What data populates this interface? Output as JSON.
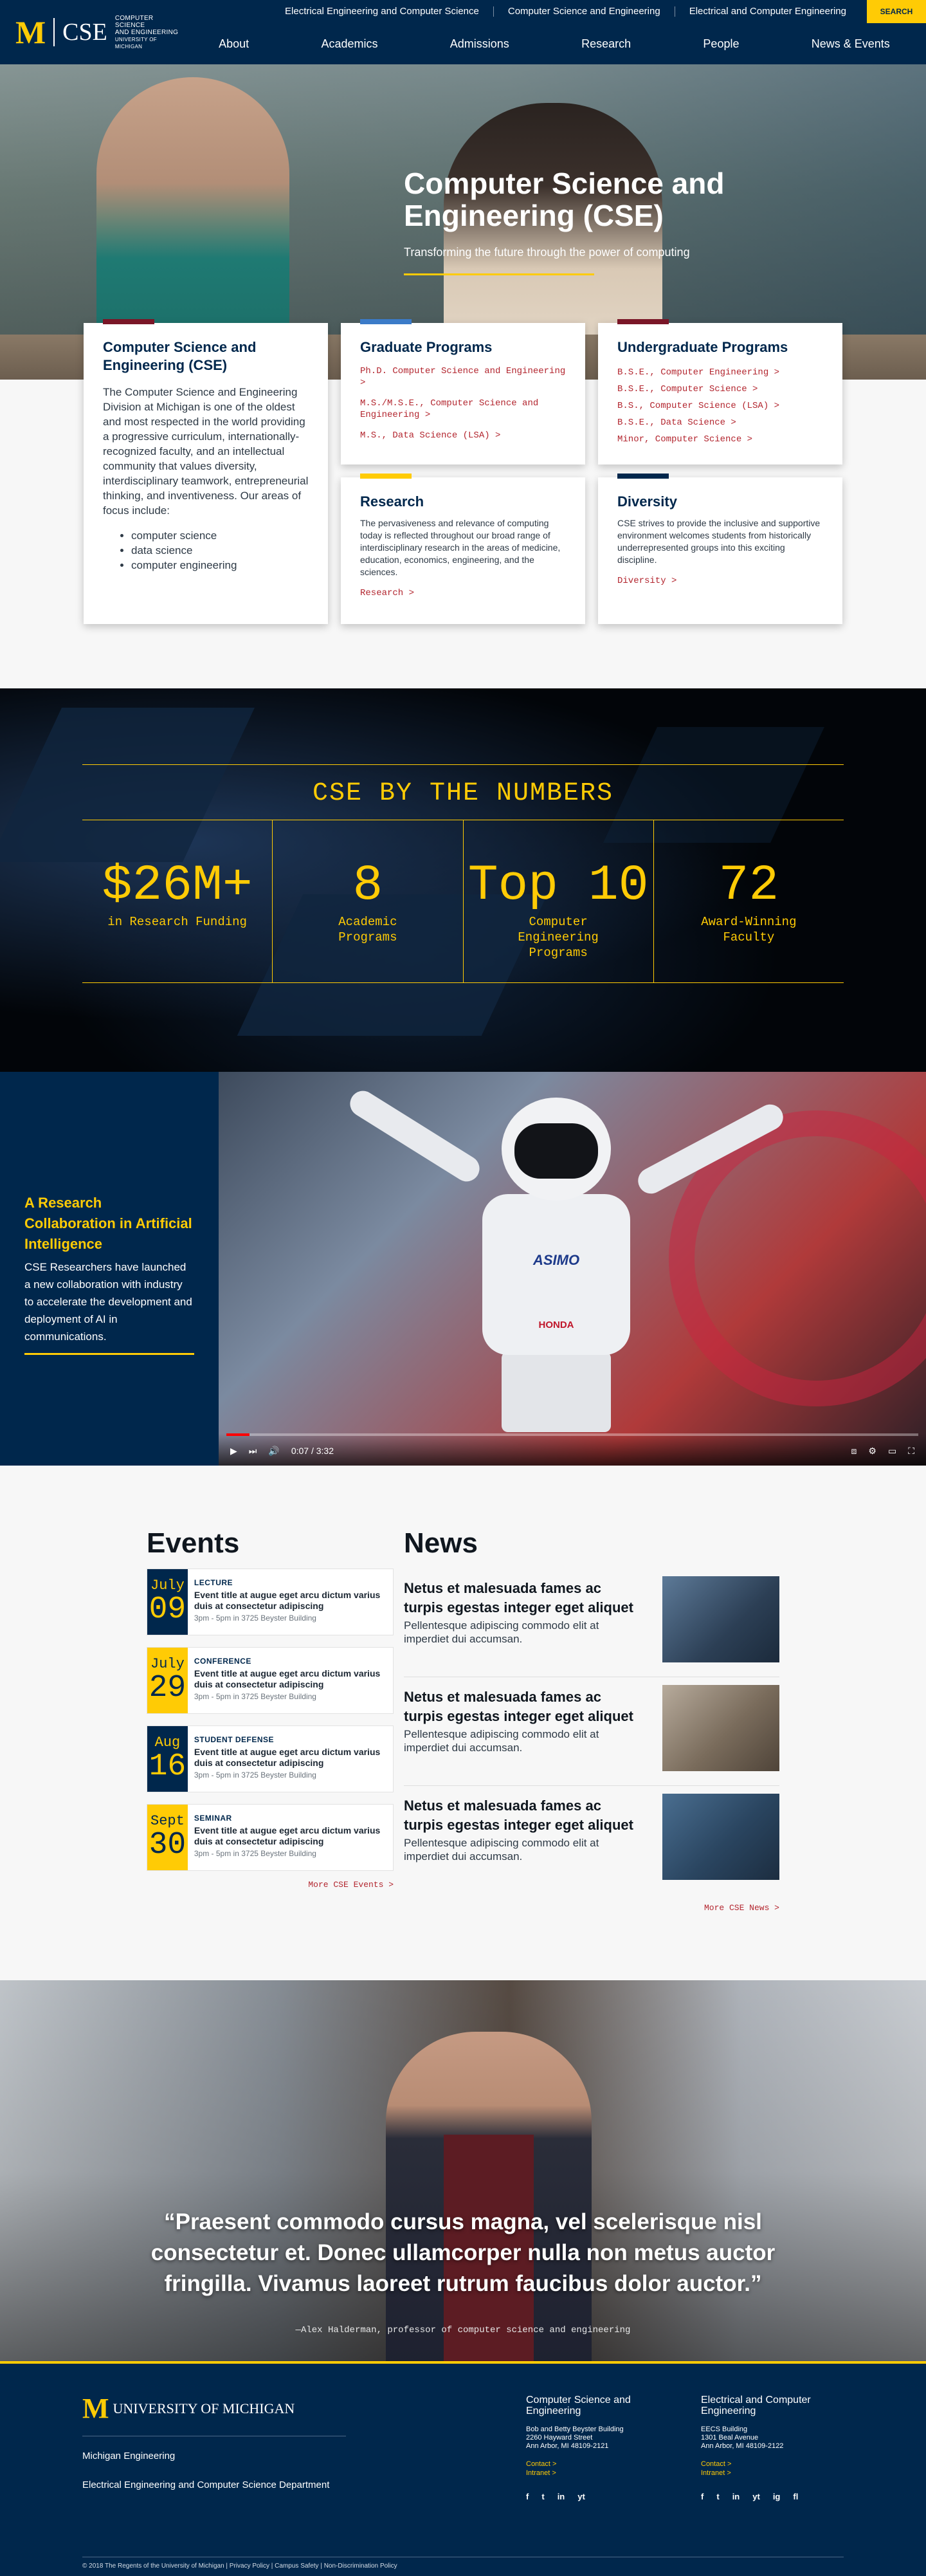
{
  "utility_bar": {
    "links": [
      "Electrical Engineering and Computer Science",
      "Computer Science and Engineering",
      "Electrical and Computer Engineering"
    ],
    "search_label": "SEARCH"
  },
  "logo": {
    "mark": "M",
    "wordmark": "CSE",
    "line1": "COMPUTER SCIENCE",
    "line2": "AND ENGINEERING",
    "line3": "UNIVERSITY OF MICHIGAN"
  },
  "nav": [
    "About",
    "Academics",
    "Admissions",
    "Research",
    "People",
    "News & Events"
  ],
  "hero": {
    "title": "Computer Science and Engineering (CSE)",
    "subtitle": "Transforming the future through the power of computing"
  },
  "cards": {
    "intro": {
      "title": "Computer Science and Engineering (CSE)",
      "body": "The Computer Science and Engineering Division at Michigan is one of the oldest and most respected in the world providing a progressive curriculum, internationally-recognized faculty, and an intellectual community that values diversity, interdisciplinary teamwork, entrepreneurial thinking, and inventiveness. Our areas of focus include:",
      "focus": [
        "computer science",
        "data science",
        "computer engineering"
      ],
      "bar_color": "#7a1627"
    },
    "graduate": {
      "title": "Graduate Programs",
      "links": [
        "Ph.D. Computer Science and Engineering >",
        "M.S./M.S.E., Computer Science and Engineering >",
        "M.S., Data Science (LSA) >"
      ],
      "bar_color": "#3b7bc8"
    },
    "undergraduate": {
      "title": "Undergraduate Programs",
      "links": [
        "B.S.E., Computer Engineering >",
        "B.S.E., Computer Science >",
        "B.S., Computer Science (LSA) >",
        "B.S.E., Data Science >",
        "Minor, Computer Science >"
      ],
      "bar_color": "#7a1627"
    },
    "research": {
      "title": "Research",
      "body": "The pervasiveness and relevance of computing today is reflected throughout our broad range of interdisciplinary research in the areas of medicine, education, economics, engineering, and the sciences.",
      "link": "Research >",
      "bar_color": "#ffcb05"
    },
    "diversity": {
      "title": "Diversity",
      "body": "CSE strives to provide the inclusive and supportive environment welcomes students from historically underrepresented groups into this exciting discipline.",
      "link": "Diversity >",
      "bar_color": "#00274c"
    }
  },
  "numbers": {
    "title": "CSE BY THE NUMBERS",
    "stats": [
      {
        "value": "$26M+",
        "label": "in Research Funding"
      },
      {
        "value": "8",
        "label": "Academic Programs"
      },
      {
        "value": "Top 10",
        "label": "Computer Engineering Programs"
      },
      {
        "value": "72",
        "label": "Award-Winning Faculty"
      }
    ]
  },
  "feature": {
    "title": "A Research Collaboration in Artificial Intelligence",
    "body": "CSE Researchers have launched a new collaboration with industry to accelerate the development and deployment of AI in communications.",
    "robot_name": "ASIMO",
    "robot_brand": "HONDA",
    "video": {
      "time": "0:07 / 3:32",
      "progress": 0.033
    }
  },
  "events": {
    "title": "Events",
    "items": [
      {
        "month": "July",
        "day": "09",
        "type": "LECTURE",
        "title": "Event title at augue eget arcu dictum varius duis at consectetur adipiscing",
        "location": "3pm - 5pm in 3725 Beyster Building",
        "style": "blue"
      },
      {
        "month": "July",
        "day": "29",
        "type": "CONFERENCE",
        "title": "Event title at augue eget arcu dictum varius duis at consectetur adipiscing",
        "location": "3pm - 5pm in 3725 Beyster Building",
        "style": "yellow"
      },
      {
        "month": "Aug",
        "day": "16",
        "type": "STUDENT DEFENSE",
        "title": "Event title at augue eget arcu dictum varius duis at consectetur adipiscing",
        "location": "3pm - 5pm in 3725 Beyster Building",
        "style": "blue"
      },
      {
        "month": "Sept",
        "day": "30",
        "type": "SEMINAR",
        "title": "Event title at augue eget arcu dictum varius duis at consectetur adipiscing",
        "location": "3pm - 5pm in 3725 Beyster Building",
        "style": "yellow"
      }
    ],
    "more": "More CSE Events >"
  },
  "news": {
    "title": "News",
    "items": [
      {
        "title": "Netus et malesuada fames ac turpis egestas integer eget aliquet",
        "body": "Pellentesque adipiscing commodo elit at imperdiet dui accumsan.",
        "image_color": "#3e5670"
      },
      {
        "title": "Netus et malesuada fames ac turpis egestas integer eget aliquet",
        "body": "Pellentesque adipiscing commodo elit at imperdiet dui accumsan.",
        "image_color": "#8b7f72"
      },
      {
        "title": "Netus et malesuada fames ac turpis egestas integer eget aliquet",
        "body": "Pellentesque adipiscing commodo elit at imperdiet dui accumsan.",
        "image_color": "#2f4a63"
      }
    ],
    "more": "More CSE News >"
  },
  "quote": {
    "text": "“Praesent commodo cursus magna, vel scelerisque nisl consectetur et. Donec ullamcorper nulla non metus auctor fringilla. Vivamus laoreet rutrum faucibus dolor auctor.”",
    "attribution": "—Alex Halderman, professor of computer science and engineering"
  },
  "footer": {
    "logo_mark": "M",
    "logo_text": "UNIVERSITY OF MICHIGAN",
    "link1": "Michigan Engineering",
    "link2": "Electrical Engineering and Computer Science Department",
    "col1": {
      "name": "Computer Science and Engineering",
      "address": [
        "Bob and Betty Beyster Building",
        "2260 Hayward Street",
        "Ann Arbor, MI  48109-2121"
      ],
      "contact": "Contact >",
      "intranet": "Intranet >",
      "social": [
        "f",
        "t",
        "in",
        "yt"
      ]
    },
    "col2": {
      "name": "Electrical and Computer Engineering",
      "address": [
        "EECS Building",
        "1301 Beal Avenue",
        "Ann Arbor, MI  48109-2122"
      ],
      "contact": "Contact >",
      "intranet": "Intranet >",
      "social": [
        "f",
        "t",
        "in",
        "yt",
        "ig",
        "fl"
      ]
    },
    "bottom": "© 2018 The Regents of the University of Michigan | Privacy Policy | Campus Safety | Non-Discrimination Policy"
  }
}
